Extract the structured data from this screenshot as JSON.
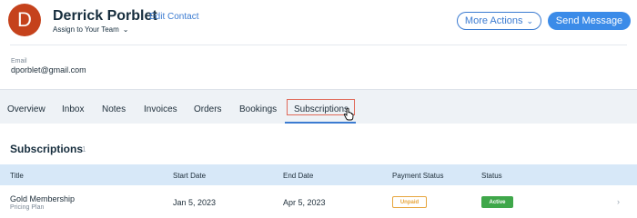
{
  "contact": {
    "avatar_initial": "D",
    "name": "Derrick Porblet",
    "edit_label": "Edit Contact",
    "assign_label": "Assign to Your Team",
    "more_actions_label": "More Actions",
    "send_message_label": "Send Message",
    "email_label": "Email",
    "email_value": "dporblet@gmail.com"
  },
  "tabs": [
    {
      "label": "Overview"
    },
    {
      "label": "Inbox"
    },
    {
      "label": "Notes"
    },
    {
      "label": "Invoices"
    },
    {
      "label": "Orders"
    },
    {
      "label": "Bookings"
    },
    {
      "label": "Subscriptions",
      "active": true
    }
  ],
  "subscriptions": {
    "title": "Subscriptions",
    "count": "1",
    "columns": [
      "Title",
      "Start Date",
      "End Date",
      "Payment Status",
      "Status"
    ],
    "rows": [
      {
        "title": "Gold Membership",
        "subtitle": "Pricing Plan",
        "start_date": "Jan 5, 2023",
        "end_date": "Apr 5, 2023",
        "payment_status": "Unpaid",
        "status": "Active"
      }
    ]
  },
  "colors": {
    "avatar": "#c5421c",
    "accent": "#3b7bd1",
    "unpaid": "#e7a53c",
    "active": "#3fa74a",
    "highlight_box": "#e06a5a"
  }
}
